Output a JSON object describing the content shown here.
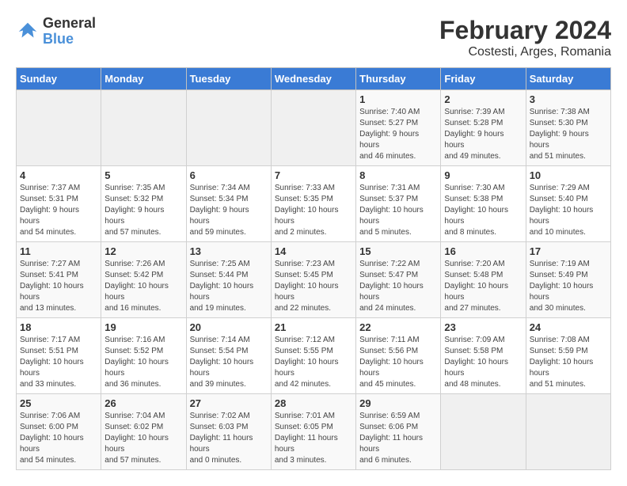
{
  "logo": {
    "text_general": "General",
    "text_blue": "Blue"
  },
  "title": "February 2024",
  "subtitle": "Costesti, Arges, Romania",
  "days_header": [
    "Sunday",
    "Monday",
    "Tuesday",
    "Wednesday",
    "Thursday",
    "Friday",
    "Saturday"
  ],
  "weeks": [
    {
      "cells": [
        {
          "empty": true
        },
        {
          "empty": true
        },
        {
          "empty": true
        },
        {
          "empty": true
        },
        {
          "day": 1,
          "sunrise": "7:40 AM",
          "sunset": "5:27 PM",
          "daylight": "9 hours and 46 minutes."
        },
        {
          "day": 2,
          "sunrise": "7:39 AM",
          "sunset": "5:28 PM",
          "daylight": "9 hours and 49 minutes."
        },
        {
          "day": 3,
          "sunrise": "7:38 AM",
          "sunset": "5:30 PM",
          "daylight": "9 hours and 51 minutes."
        }
      ]
    },
    {
      "cells": [
        {
          "day": 4,
          "sunrise": "7:37 AM",
          "sunset": "5:31 PM",
          "daylight": "9 hours and 54 minutes."
        },
        {
          "day": 5,
          "sunrise": "7:35 AM",
          "sunset": "5:32 PM",
          "daylight": "9 hours and 57 minutes."
        },
        {
          "day": 6,
          "sunrise": "7:34 AM",
          "sunset": "5:34 PM",
          "daylight": "9 hours and 59 minutes."
        },
        {
          "day": 7,
          "sunrise": "7:33 AM",
          "sunset": "5:35 PM",
          "daylight": "10 hours and 2 minutes."
        },
        {
          "day": 8,
          "sunrise": "7:31 AM",
          "sunset": "5:37 PM",
          "daylight": "10 hours and 5 minutes."
        },
        {
          "day": 9,
          "sunrise": "7:30 AM",
          "sunset": "5:38 PM",
          "daylight": "10 hours and 8 minutes."
        },
        {
          "day": 10,
          "sunrise": "7:29 AM",
          "sunset": "5:40 PM",
          "daylight": "10 hours and 10 minutes."
        }
      ]
    },
    {
      "cells": [
        {
          "day": 11,
          "sunrise": "7:27 AM",
          "sunset": "5:41 PM",
          "daylight": "10 hours and 13 minutes."
        },
        {
          "day": 12,
          "sunrise": "7:26 AM",
          "sunset": "5:42 PM",
          "daylight": "10 hours and 16 minutes."
        },
        {
          "day": 13,
          "sunrise": "7:25 AM",
          "sunset": "5:44 PM",
          "daylight": "10 hours and 19 minutes."
        },
        {
          "day": 14,
          "sunrise": "7:23 AM",
          "sunset": "5:45 PM",
          "daylight": "10 hours and 22 minutes."
        },
        {
          "day": 15,
          "sunrise": "7:22 AM",
          "sunset": "5:47 PM",
          "daylight": "10 hours and 24 minutes."
        },
        {
          "day": 16,
          "sunrise": "7:20 AM",
          "sunset": "5:48 PM",
          "daylight": "10 hours and 27 minutes."
        },
        {
          "day": 17,
          "sunrise": "7:19 AM",
          "sunset": "5:49 PM",
          "daylight": "10 hours and 30 minutes."
        }
      ]
    },
    {
      "cells": [
        {
          "day": 18,
          "sunrise": "7:17 AM",
          "sunset": "5:51 PM",
          "daylight": "10 hours and 33 minutes."
        },
        {
          "day": 19,
          "sunrise": "7:16 AM",
          "sunset": "5:52 PM",
          "daylight": "10 hours and 36 minutes."
        },
        {
          "day": 20,
          "sunrise": "7:14 AM",
          "sunset": "5:54 PM",
          "daylight": "10 hours and 39 minutes."
        },
        {
          "day": 21,
          "sunrise": "7:12 AM",
          "sunset": "5:55 PM",
          "daylight": "10 hours and 42 minutes."
        },
        {
          "day": 22,
          "sunrise": "7:11 AM",
          "sunset": "5:56 PM",
          "daylight": "10 hours and 45 minutes."
        },
        {
          "day": 23,
          "sunrise": "7:09 AM",
          "sunset": "5:58 PM",
          "daylight": "10 hours and 48 minutes."
        },
        {
          "day": 24,
          "sunrise": "7:08 AM",
          "sunset": "5:59 PM",
          "daylight": "10 hours and 51 minutes."
        }
      ]
    },
    {
      "cells": [
        {
          "day": 25,
          "sunrise": "7:06 AM",
          "sunset": "6:00 PM",
          "daylight": "10 hours and 54 minutes."
        },
        {
          "day": 26,
          "sunrise": "7:04 AM",
          "sunset": "6:02 PM",
          "daylight": "10 hours and 57 minutes."
        },
        {
          "day": 27,
          "sunrise": "7:02 AM",
          "sunset": "6:03 PM",
          "daylight": "11 hours and 0 minutes."
        },
        {
          "day": 28,
          "sunrise": "7:01 AM",
          "sunset": "6:05 PM",
          "daylight": "11 hours and 3 minutes."
        },
        {
          "day": 29,
          "sunrise": "6:59 AM",
          "sunset": "6:06 PM",
          "daylight": "11 hours and 6 minutes."
        },
        {
          "empty": true
        },
        {
          "empty": true
        }
      ]
    }
  ],
  "labels": {
    "sunrise": "Sunrise:",
    "sunset": "Sunset:",
    "daylight": "Daylight:"
  }
}
